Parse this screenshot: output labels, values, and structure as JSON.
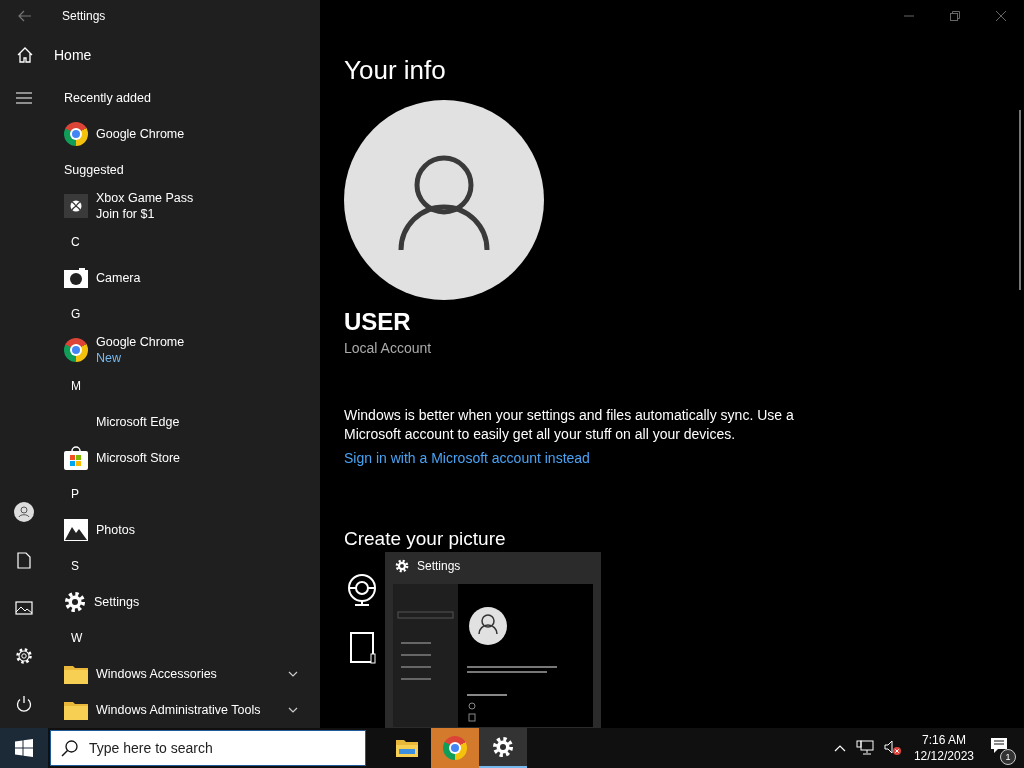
{
  "settings_window": {
    "title": "Settings",
    "home": "Home",
    "page_title": "Your info",
    "account_name": "USER",
    "account_type": "Local Account",
    "sync_message": "Windows is better when your settings and files automatically sync. Use a Microsoft account to easily get all your stuff on all your devices.",
    "sign_in_link": "Sign in with a Microsoft account instead",
    "section_title": "Create your picture"
  },
  "start_menu": {
    "items": [
      {
        "kind": "section",
        "label": "Recently added"
      },
      {
        "kind": "chrome",
        "name": "Google Chrome"
      },
      {
        "kind": "section",
        "label": "Suggested"
      },
      {
        "kind": "xbox",
        "name": "Xbox Game Pass",
        "subtitle": "Join for $1"
      },
      {
        "kind": "letter",
        "label": "C"
      },
      {
        "kind": "camera",
        "name": "Camera"
      },
      {
        "kind": "letter",
        "label": "G"
      },
      {
        "kind": "chrome",
        "name": "Google Chrome",
        "badge": "New"
      },
      {
        "kind": "letter",
        "label": "M"
      },
      {
        "kind": "edge",
        "name": "Microsoft Edge"
      },
      {
        "kind": "store",
        "name": "Microsoft Store"
      },
      {
        "kind": "letter",
        "label": "P"
      },
      {
        "kind": "photos",
        "name": "Photos"
      },
      {
        "kind": "letter",
        "label": "S"
      },
      {
        "kind": "settings",
        "name": "Settings"
      },
      {
        "kind": "letter",
        "label": "W"
      },
      {
        "kind": "folder",
        "name": "Windows Accessories",
        "expandable": true
      },
      {
        "kind": "folder",
        "name": "Windows Administrative Tools",
        "expandable": true
      }
    ]
  },
  "preview": {
    "title": "Settings"
  },
  "taskbar": {
    "search_placeholder": "Type here to search",
    "apps": [
      {
        "kind": "explorer",
        "flashing": false,
        "selected": false
      },
      {
        "kind": "chrome",
        "flashing": true,
        "selected": false
      },
      {
        "kind": "settings",
        "flashing": false,
        "selected": true
      }
    ],
    "time": "7:16 AM",
    "date": "12/12/2023",
    "notification_count": "1"
  }
}
